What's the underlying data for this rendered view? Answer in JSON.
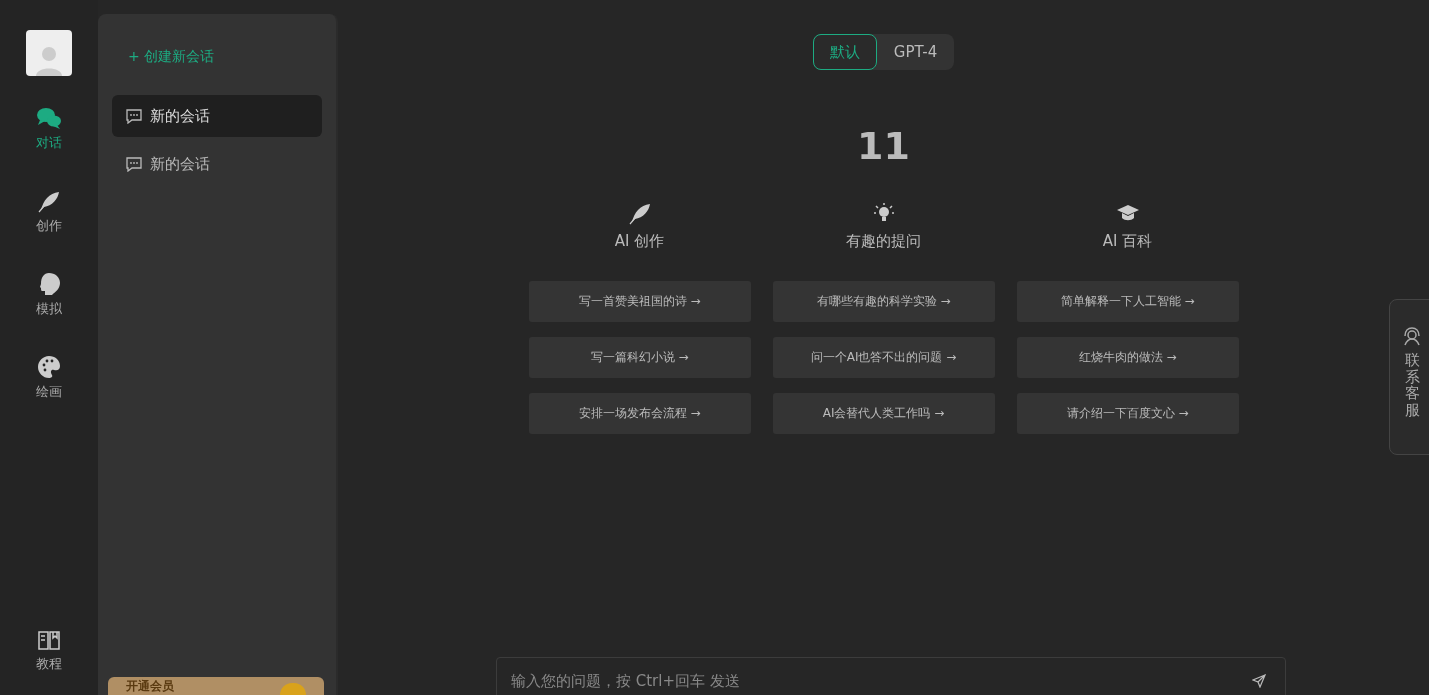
{
  "nav": {
    "items": [
      {
        "kind": "chat",
        "label": "对话",
        "selected": true
      },
      {
        "kind": "feather",
        "label": "创作",
        "selected": false
      },
      {
        "kind": "head",
        "label": "模拟",
        "selected": false
      },
      {
        "kind": "palette",
        "label": "绘画",
        "selected": false
      }
    ],
    "bottom": {
      "label": "教程"
    }
  },
  "sidebar": {
    "new_chat": "+ 创建新会话",
    "items": [
      {
        "label": "新的会话",
        "selected": true
      },
      {
        "label": "新的会话",
        "selected": false
      }
    ],
    "promo": {
      "label": "开通会员"
    }
  },
  "model_tabs": [
    {
      "label": "默认",
      "selected": true
    },
    {
      "label": "GPT-4",
      "selected": false
    }
  ],
  "title": "11",
  "columns": [
    {
      "kind": "feather",
      "heading": "AI 创作",
      "prompts": [
        "写一首赞美祖国的诗 →",
        "写一篇科幻小说 →",
        "安排一场发布会流程 →"
      ]
    },
    {
      "kind": "bulb",
      "heading": "有趣的提问",
      "prompts": [
        "有哪些有趣的科学实验 →",
        "问一个AI也答不出的问题 →",
        "AI会替代人类工作吗 →"
      ]
    },
    {
      "kind": "cap",
      "heading": "AI 百科",
      "prompts": [
        "简单解释一下人工智能 →",
        "红烧牛肉的做法 →",
        "请介绍一下百度文心 →"
      ]
    }
  ],
  "input": {
    "placeholder": "输入您的问题，按 Ctrl+回车 发送"
  },
  "support": {
    "label": "联系客服"
  }
}
